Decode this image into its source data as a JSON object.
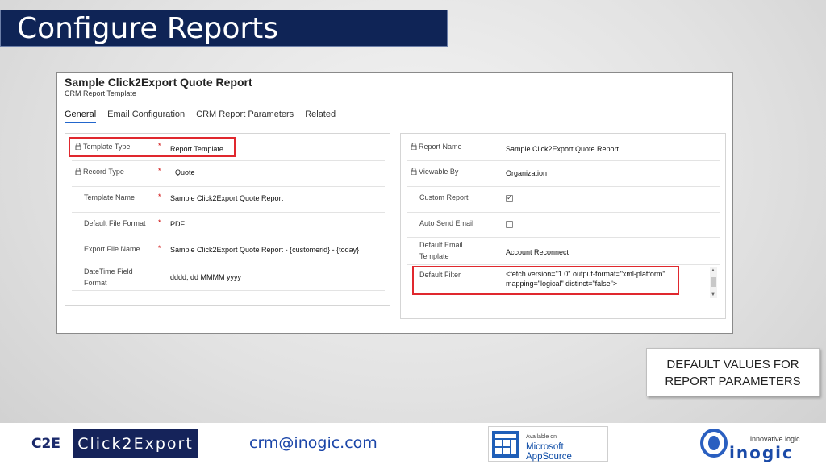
{
  "slide_title": "Configure Reports",
  "record": {
    "title": "Sample Click2Export Quote Report",
    "subtitle": "CRM Report Template"
  },
  "tabs": [
    "General",
    "Email Configuration",
    "CRM Report Parameters",
    "Related"
  ],
  "active_tab": "General",
  "left_fields": [
    {
      "label": "Template Type",
      "locked": true,
      "required": true,
      "value": "Report Template",
      "highlighted": true
    },
    {
      "label": "Record Type",
      "locked": true,
      "required": true,
      "value": "Quote"
    },
    {
      "label": "Template Name",
      "required": true,
      "value": "Sample Click2Export Quote Report"
    },
    {
      "label": "Default File Format",
      "required": true,
      "value": "PDF"
    },
    {
      "label": "Export File Name",
      "required": true,
      "value": "Sample Click2Export Quote Report - {customerid} - {today}"
    },
    {
      "label": "DateTime Field Format",
      "label_line1": "DateTime Field",
      "label_line2": "Format",
      "value": "dddd, dd MMMM yyyy"
    }
  ],
  "right_fields": [
    {
      "label": "Report Name",
      "locked": true,
      "value": "Sample Click2Export Quote Report"
    },
    {
      "label": "Viewable By",
      "locked": true,
      "value": "Organization"
    },
    {
      "label": "Custom Report",
      "checkbox": true,
      "checked": true
    },
    {
      "label": "Auto Send Email",
      "checkbox": true,
      "checked": false
    },
    {
      "label": "Default Email Template",
      "label_line1": "Default Email",
      "label_line2": "Template",
      "value": "Account Reconnect"
    },
    {
      "label": "Default Filter",
      "value_line1": "<fetch version=\"1.0\" output-format=\"xml-platform\"",
      "value_line2": "mapping=\"logical\" distinct=\"false\">",
      "highlighted": true
    }
  ],
  "callout": {
    "line1": "DEFAULT VALUES FOR",
    "line2": "REPORT PARAMETERS"
  },
  "footer": {
    "logo_c2e_left": "C2E",
    "logo_c2e_right": "Click2Export",
    "email": "crm@inogic.com",
    "appsource_small": "Available on",
    "appsource_main": "Microsoft AppSource",
    "inogic_tagline": "innovative logic",
    "inogic_word": "inogic"
  },
  "colors": {
    "title_bg": "#0f2456",
    "highlight": "#e0282e",
    "tab_underline": "#2266cc",
    "required": "#cc0000"
  }
}
